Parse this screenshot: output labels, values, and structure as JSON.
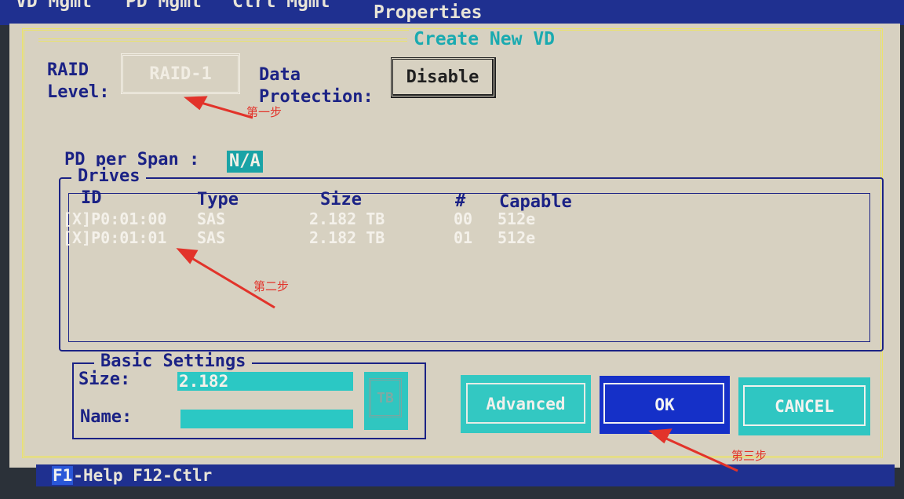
{
  "menu": {
    "items": [
      "VD Mgmt",
      "PD Mgmt",
      "Ctrl Mgmt",
      "Properties"
    ]
  },
  "dialog": {
    "title": "Create New VD",
    "raid_level_label": "RAID\nLevel:",
    "raid_level_value": "RAID-1",
    "data_protection_label": "Data\nProtection:",
    "data_protection_value": "Disable",
    "pd_per_span_label": "PD per Span :",
    "pd_per_span_value": "N/A"
  },
  "drives": {
    "legend": "Drives",
    "columns": [
      "ID",
      "Type",
      "Size",
      "#",
      "Capable"
    ],
    "rows": [
      {
        "id": "[X]P0:01:00",
        "type": "SAS",
        "size": "2.182 TB",
        "num": "00",
        "capable": "512e"
      },
      {
        "id": "[X]P0:01:01",
        "type": "SAS",
        "size": "2.182 TB",
        "num": "01",
        "capable": "512e"
      }
    ]
  },
  "basic_settings": {
    "legend": "Basic Settings",
    "size_label": "Size:",
    "size_value": "2.182",
    "name_label": "Name:",
    "name_value": "",
    "unit": "TB"
  },
  "buttons": {
    "advanced": "Advanced",
    "ok": "OK",
    "cancel": "CANCEL"
  },
  "statusbar": {
    "f1_key": "F1",
    "text": "-Help F12-Ctlr"
  },
  "annotations": {
    "step1": "第一步",
    "step2": "第二步",
    "step3": "第三步"
  },
  "colors": {
    "dialog_bg": "#d7d1c1",
    "menubar_bg": "#1f3090",
    "label_blue": "#1b2285",
    "teal": "#2bc8c4",
    "ok_blue": "#1530c8",
    "annotation_red": "#e2332a",
    "frame_yellow": "#ebe36a"
  }
}
